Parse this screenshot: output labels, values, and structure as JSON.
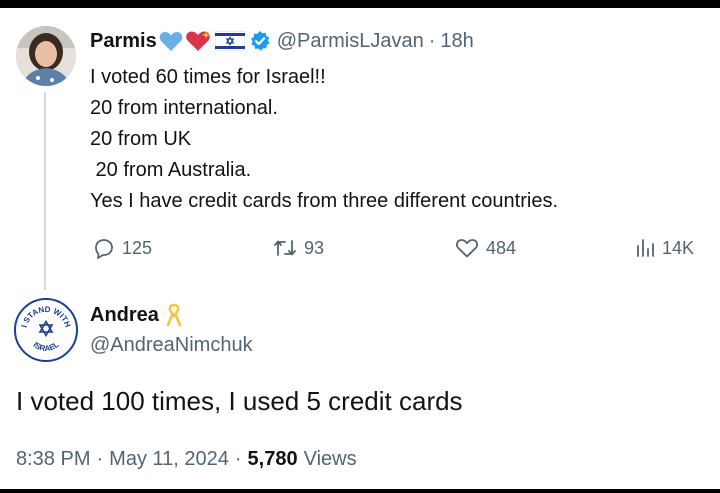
{
  "tweet1": {
    "author_name": "Parmis",
    "handle": "@ParmisLJavan",
    "separator": "·",
    "time": "18h",
    "lines": [
      "I voted 60 times for Israel!!",
      "20 from international.",
      "20 from UK",
      " 20 from Australia.",
      "Yes I have credit cards from three different countries."
    ],
    "stats": {
      "replies": "125",
      "reposts": "93",
      "likes": "484",
      "views": "14K"
    }
  },
  "tweet2": {
    "author_name": "Andrea",
    "handle": "@AndreaNimchuk",
    "avatar_text": {
      "top": "I STAND WITH",
      "bottom": "ISRAEL"
    },
    "text": "I voted 100 times, I used 5 credit cards",
    "time": "8:38 PM",
    "separator": "·",
    "date": "May 11, 2024",
    "views_count": "5,780",
    "views_label": "Views"
  },
  "colors": {
    "text": "#0f1419",
    "secondary": "#536471",
    "verified": "#1d9bf0",
    "thread_line": "#cfd9de",
    "israel_blue": "#1b3f91",
    "ribbon": "#f4c542"
  }
}
